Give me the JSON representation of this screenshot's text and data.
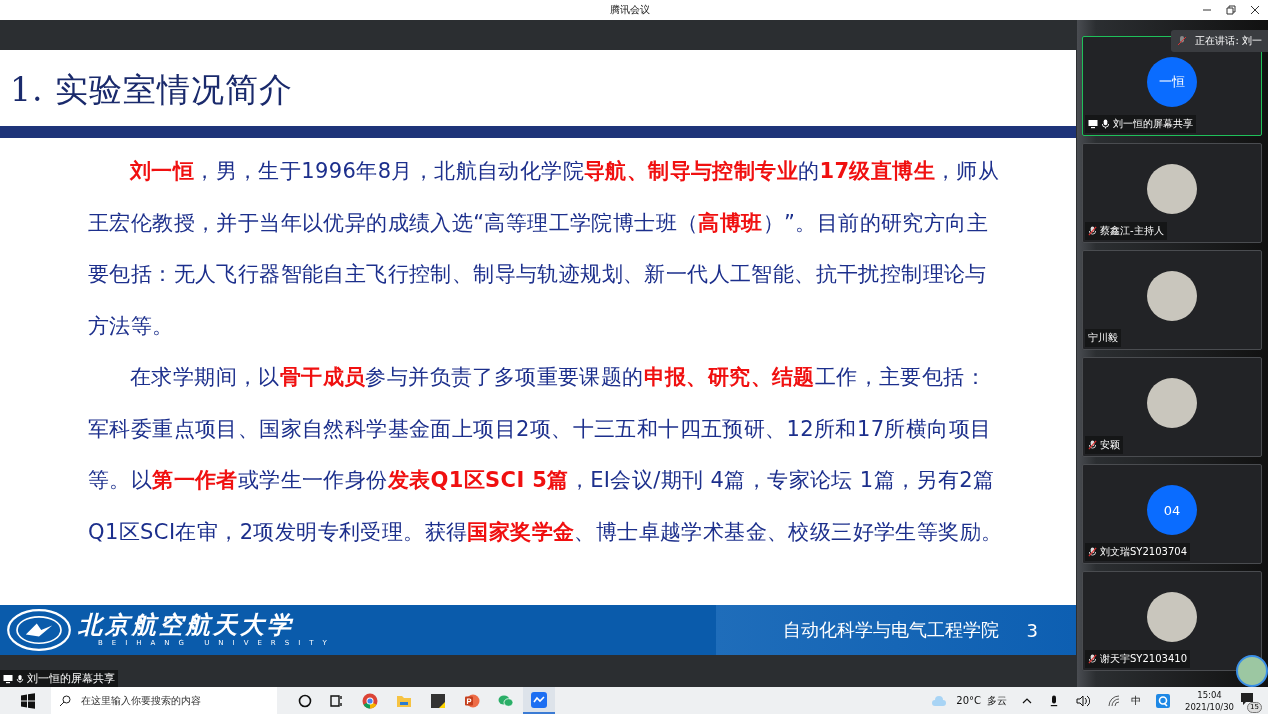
{
  "window": {
    "title": "腾讯会议"
  },
  "slide": {
    "title": "1. 实验室情况简介",
    "paragraphs": [
      "**刘一恒**，男，生于1996年8月，北航自动化学院**导航、制导与控制专业**的**17级直博生**，师从王宏伦教授，并于当年以优异的成绩入选“高等理工学院博士班（**高博班**）”。目前的研究方向主要包括：无人飞行器智能自主飞行控制、制导与轨迹规划、新一代人工智能、抗干扰控制理论与方法等。",
      "在求学期间，以**骨干成员**参与并负责了多项重要课题的**申报、研究、结题**工作，主要包括：军科委重点项目、国家自然科学基金面上项目2项、十三五和十四五预研、12所和17所横向项目等。以**第一作者**或学生一作身份**发表Q1区SCI 5篇**，EI会议/期刊 4篇，专家论坛 1篇，另有2篇Q1区SCI在审，2项发明专利受理。获得**国家奖学金**、博士卓越学术基金、校级三好学生等奖励。"
    ],
    "university_name": "北京航空航天大学",
    "university_english": "BEIHANG UNIVERSITY",
    "school": "自动化科学与电气工程学院",
    "page_number": "3"
  },
  "share_label": "刘一恒的屏幕共享",
  "speaking_indicator": "正在讲话: 刘一",
  "participants": [
    {
      "name": "刘一恒的屏幕共享",
      "kind": "initials",
      "initials": "一恒",
      "muted": false,
      "sharing": true,
      "speaking": true
    },
    {
      "name": "蔡鑫江-主持人",
      "kind": "photo",
      "muted": true,
      "sharing": false,
      "speaking": false
    },
    {
      "name": "宁川毅",
      "kind": "photo",
      "sharing": false,
      "speaking": false
    },
    {
      "name": "安颖",
      "kind": "photo",
      "muted": true,
      "sharing": false,
      "speaking": false
    },
    {
      "name": "刘文瑞SY2103704",
      "kind": "initials",
      "initials": "04",
      "muted": true,
      "sharing": false,
      "speaking": false
    },
    {
      "name": "谢天宇SY2103410",
      "kind": "photo",
      "muted": true,
      "sharing": false,
      "speaking": false
    }
  ],
  "taskbar": {
    "search_placeholder": "在这里输入你要搜索的内容",
    "temperature": "20°C",
    "weather": "多云",
    "ime": "中",
    "time": "15:04",
    "date": "2021/10/30",
    "notifications": "15"
  }
}
